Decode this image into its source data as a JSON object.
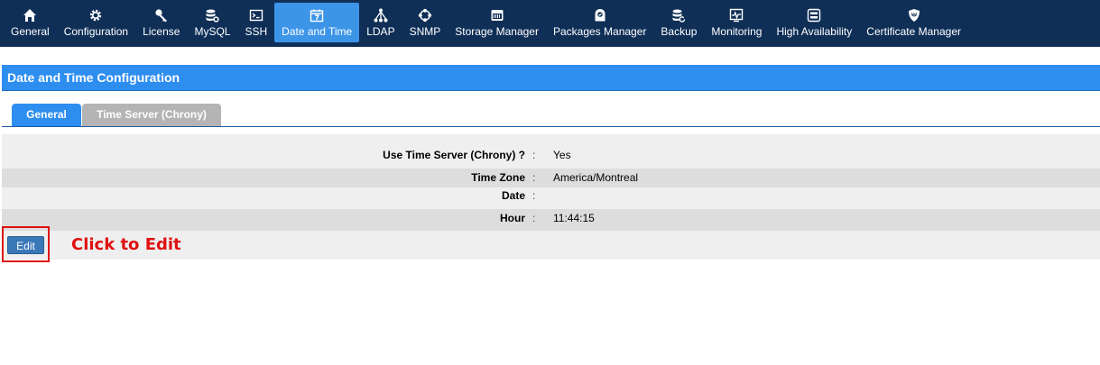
{
  "nav": {
    "items": [
      {
        "label": "General",
        "icon": "home-icon"
      },
      {
        "label": "Configuration",
        "icon": "gear-icon"
      },
      {
        "label": "License",
        "icon": "key-icon"
      },
      {
        "label": "MySQL",
        "icon": "database-gear-icon"
      },
      {
        "label": "SSH",
        "icon": "terminal-icon"
      },
      {
        "label": "Date and Time",
        "icon": "calendar-icon",
        "active": true
      },
      {
        "label": "LDAP",
        "icon": "hierarchy-icon"
      },
      {
        "label": "SNMP",
        "icon": "network-ring-icon"
      },
      {
        "label": "Storage Manager",
        "icon": "storage-icon"
      },
      {
        "label": "Packages Manager",
        "icon": "package-icon"
      },
      {
        "label": "Backup",
        "icon": "database-refresh-icon"
      },
      {
        "label": "Monitoring",
        "icon": "heartbeat-monitor-icon"
      },
      {
        "label": "High Availability",
        "icon": "server-stack-icon"
      },
      {
        "label": "Certificate Manager",
        "icon": "shield-icon"
      }
    ]
  },
  "page": {
    "title": "Date and Time Configuration"
  },
  "tabs": [
    {
      "label": "General",
      "active": true
    },
    {
      "label": "Time Server (Chrony)",
      "active": false
    }
  ],
  "form": {
    "rows": [
      {
        "label": "Use Time Server (Chrony) ?",
        "sep": ":",
        "value": "Yes"
      },
      {
        "label": "Time Zone",
        "sep": ":",
        "value": "America/Montreal"
      },
      {
        "label": "Date",
        "sep": ":",
        "value": ""
      },
      {
        "label": "Hour",
        "sep": ":",
        "value": "11:44:15"
      }
    ]
  },
  "actions": {
    "edit_label": "Edit"
  },
  "annotation": {
    "text": "Click to Edit"
  },
  "colors": {
    "nav_bg": "#0f2f57",
    "accent": "#2e8ef0",
    "annotation_red": "#e01010"
  }
}
